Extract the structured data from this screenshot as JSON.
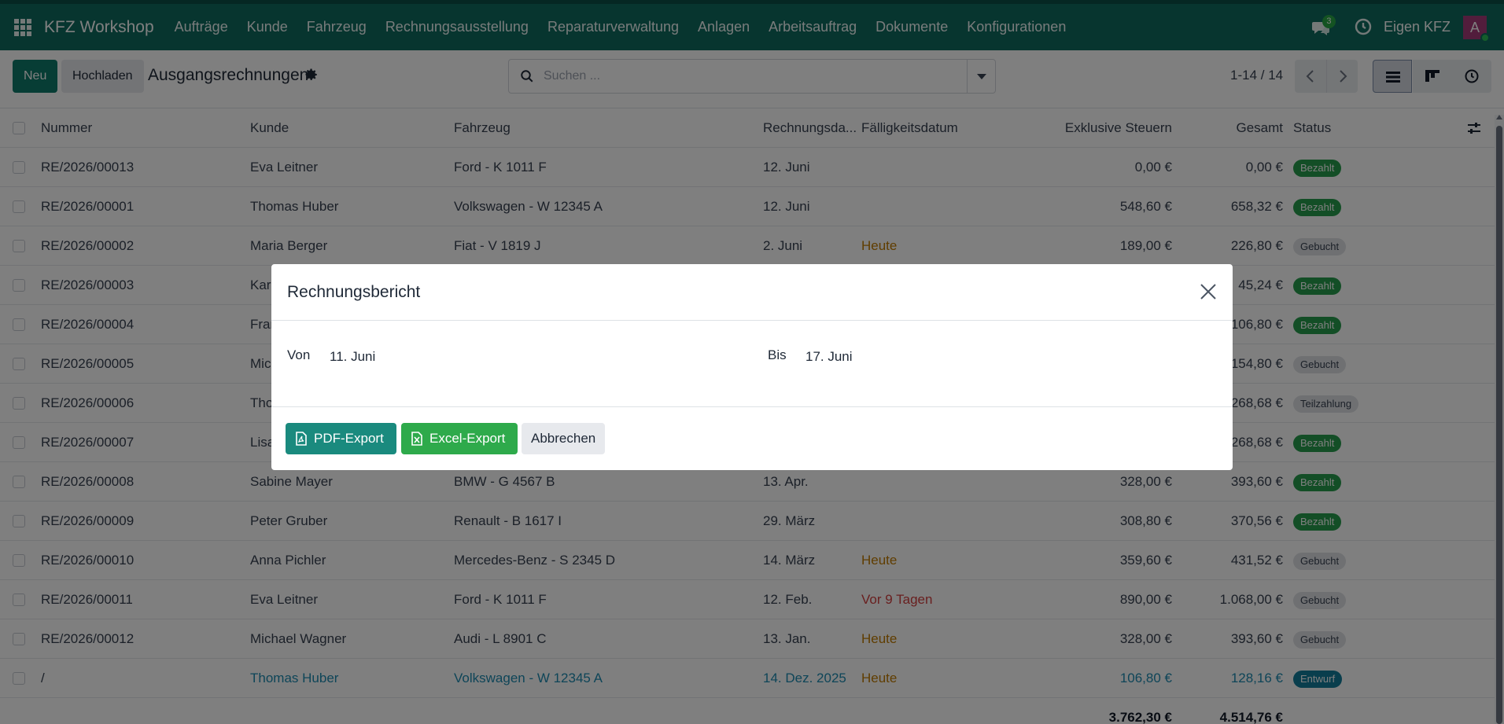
{
  "navbar": {
    "brand": "KFZ Workshop",
    "menu": [
      "Aufträge",
      "Kunde",
      "Fahrzeug",
      "Rechnungsausstellung",
      "Reparaturverwaltung",
      "Anlagen",
      "Arbeitsauftrag",
      "Dokumente",
      "Konfigurationen"
    ],
    "chat_count": "3",
    "company": "Eigen KFZ",
    "avatar_initial": "A"
  },
  "control": {
    "new_label": "Neu",
    "upload_label": "Hochladen",
    "title": "Ausgangsrechnungen",
    "search_placeholder": "Suchen ...",
    "pager": "1-14 / 14"
  },
  "table": {
    "headers": {
      "number": "Nummer",
      "customer": "Kunde",
      "vehicle": "Fahrzeug",
      "invoice_date": "Rechnungsda...",
      "due_date": "Fälligkeitsdatum",
      "net": "Exklusive Steuern",
      "total": "Gesamt",
      "status": "Status"
    },
    "rows": [
      {
        "number": "RE/2026/00013",
        "customer": "Eva Leitner",
        "vehicle": "Ford - K 1011 F",
        "date": "12. Juni",
        "due": "",
        "due_style": "",
        "net": "0,00 €",
        "total": "0,00 €",
        "status": "Bezahlt",
        "status_style": "green"
      },
      {
        "number": "RE/2026/00001",
        "customer": "Thomas Huber",
        "vehicle": "Volkswagen - W 12345 A",
        "date": "12. Juni",
        "due": "",
        "due_style": "",
        "net": "548,60 €",
        "total": "658,32 €",
        "status": "Bezahlt",
        "status_style": "green"
      },
      {
        "number": "RE/2026/00002",
        "customer": "Maria Berger",
        "vehicle": "Fiat - V 1819 J",
        "date": "2. Juni",
        "due": "Heute",
        "due_style": "orange",
        "net": "189,00 €",
        "total": "226,80 €",
        "status": "Gebucht",
        "status_style": "grey"
      },
      {
        "number": "RE/2026/00003",
        "customer": "Karl",
        "vehicle": "",
        "date": "",
        "due": "",
        "due_style": "",
        "net": "",
        "total": "45,24 €",
        "status": "Bezahlt",
        "status_style": "green"
      },
      {
        "number": "RE/2026/00004",
        "customer": "Fran",
        "vehicle": "",
        "date": "",
        "due": "",
        "due_style": "",
        "net": "",
        "total": "106,80 €",
        "status": "Bezahlt",
        "status_style": "green"
      },
      {
        "number": "RE/2026/00005",
        "customer": "Mic",
        "vehicle": "",
        "date": "",
        "due": "",
        "due_style": "",
        "net": "",
        "total": "154,80 €",
        "status": "Gebucht",
        "status_style": "grey"
      },
      {
        "number": "RE/2026/00006",
        "customer": "Tho",
        "vehicle": "",
        "date": "",
        "due": "",
        "due_style": "",
        "net": "",
        "total": "268,68 €",
        "status": "Teilzahlung",
        "status_style": "grey"
      },
      {
        "number": "RE/2026/00007",
        "customer": "Lisa",
        "vehicle": "",
        "date": "",
        "due": "",
        "due_style": "",
        "net": "",
        "total": "268,68 €",
        "status": "Bezahlt",
        "status_style": "green"
      },
      {
        "number": "RE/2026/00008",
        "customer": "Sabine Mayer",
        "vehicle": "BMW - G 4567 B",
        "date": "13. Apr.",
        "due": "",
        "due_style": "",
        "net": "328,00 €",
        "total": "393,60 €",
        "status": "Bezahlt",
        "status_style": "green"
      },
      {
        "number": "RE/2026/00009",
        "customer": "Peter Gruber",
        "vehicle": "Renault - B 1617 I",
        "date": "29. März",
        "due": "",
        "due_style": "",
        "net": "308,80 €",
        "total": "370,56 €",
        "status": "Bezahlt",
        "status_style": "green"
      },
      {
        "number": "RE/2026/00010",
        "customer": "Anna Pichler",
        "vehicle": "Mercedes-Benz - S 2345 D",
        "date": "14. März",
        "due": "Heute",
        "due_style": "orange",
        "net": "359,60 €",
        "total": "431,52 €",
        "status": "Gebucht",
        "status_style": "grey"
      },
      {
        "number": "RE/2026/00011",
        "customer": "Eva Leitner",
        "vehicle": "Ford - K 1011 F",
        "date": "12. Feb.",
        "due": "Vor 9 Tagen",
        "due_style": "red",
        "net": "890,00 €",
        "total": "1.068,00 €",
        "status": "Gebucht",
        "status_style": "grey"
      },
      {
        "number": "RE/2026/00012",
        "customer": "Michael Wagner",
        "vehicle": "Audi - L 8901 C",
        "date": "13. Jan.",
        "due": "Heute",
        "due_style": "orange",
        "net": "328,00 €",
        "total": "393,60 €",
        "status": "Gebucht",
        "status_style": "grey"
      },
      {
        "number": "/",
        "customer": "Thomas Huber",
        "vehicle": "Volkswagen - W 12345 A",
        "date": "14. Dez. 2025",
        "due": "Heute",
        "due_style": "orange",
        "net": "106,80 €",
        "total": "128,16 €",
        "status": "Entwurf",
        "status_style": "teal",
        "draft": true
      }
    ],
    "sum_net": "3.762,30 €",
    "sum_total": "4.514,76 €"
  },
  "modal": {
    "title": "Rechnungsbericht",
    "from_label": "Von",
    "from_value": "11. Juni",
    "to_label": "Bis",
    "to_value": "17. Juni",
    "pdf_label": "PDF-Export",
    "excel_label": "Excel-Export",
    "cancel_label": "Abbrechen"
  },
  "colors": {
    "navbar": "#0f6b5f",
    "primary": "#0f7a6b",
    "paid": "#279c4c",
    "draft": "#127d9a"
  }
}
